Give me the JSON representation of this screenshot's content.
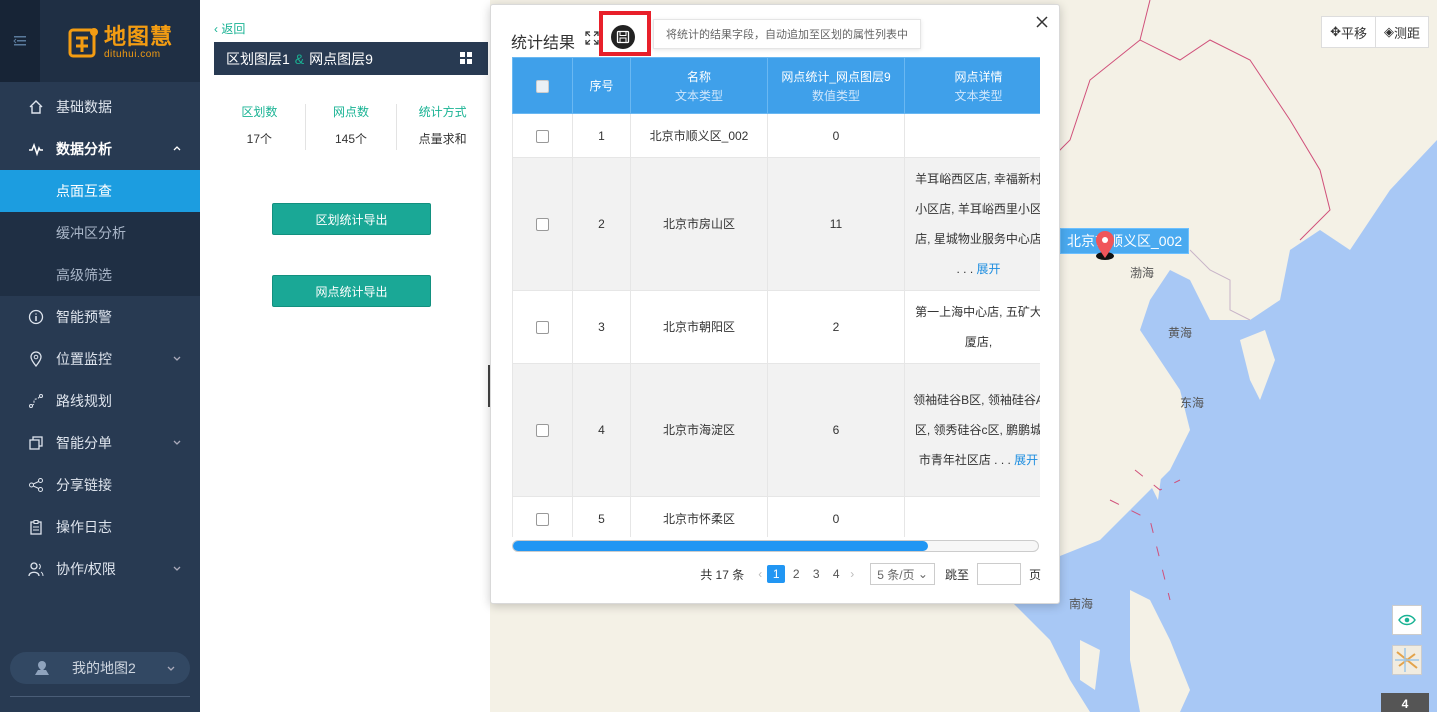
{
  "brand": {
    "name_cn": "地图慧",
    "name_en": "dituhui.com"
  },
  "sidebar": {
    "items": [
      {
        "label": "基础数据",
        "icon": "home-icon"
      },
      {
        "label": "数据分析",
        "icon": "analytics-icon",
        "expanded": true,
        "children": [
          {
            "label": "点面互查",
            "active": true
          },
          {
            "label": "缓冲区分析"
          },
          {
            "label": "高级筛选"
          }
        ]
      },
      {
        "label": "智能预警",
        "icon": "info-icon"
      },
      {
        "label": "位置监控",
        "icon": "location-icon"
      },
      {
        "label": "路线规划",
        "icon": "route-icon"
      },
      {
        "label": "智能分单",
        "icon": "copy-icon"
      },
      {
        "label": "分享链接",
        "icon": "share-icon"
      },
      {
        "label": "操作日志",
        "icon": "clipboard-icon"
      },
      {
        "label": "协作/权限",
        "icon": "users-icon"
      }
    ],
    "my_map": "我的地图2"
  },
  "panel": {
    "back": "返回",
    "layer_a": "区划图层1",
    "amp": "&",
    "layer_b": "网点图层9",
    "stats": [
      {
        "key": "区划数",
        "value": "17个"
      },
      {
        "key": "网点数",
        "value": "145个"
      },
      {
        "key": "统计方式",
        "value": "点量求和"
      }
    ],
    "export_region": "区划统计导出",
    "export_point": "网点统计导出"
  },
  "modal": {
    "title": "统计结果",
    "tooltip": "将统计的结果字段，自动追加至区划的属性列表中",
    "columns": [
      {
        "label": "序号",
        "type": ""
      },
      {
        "label": "名称",
        "type": "文本类型"
      },
      {
        "label": "网点统计_网点图层9",
        "type": "数值类型"
      },
      {
        "label": "网点详情",
        "type": "文本类型"
      }
    ],
    "rows": [
      {
        "index": "1",
        "name": "北京市顺义区_002",
        "count": "0",
        "detail": "",
        "more": ""
      },
      {
        "index": "2",
        "name": "北京市房山区",
        "count": "11",
        "detail": "羊耳峪西区店, 幸福新村小区店, 羊耳峪西里小区店, 星城物业服务中心店 . . .",
        "more": "展开"
      },
      {
        "index": "3",
        "name": "北京市朝阳区",
        "count": "2",
        "detail": "第一上海中心店, 五矿大厦店,",
        "more": ""
      },
      {
        "index": "4",
        "name": "北京市海淀区",
        "count": "6",
        "detail": "领袖硅谷B区, 领袖硅谷A区, 领秀硅谷c区, 鹏鹏城市青年社区店 . . .",
        "more": "展开"
      },
      {
        "index": "5",
        "name": "北京市怀柔区",
        "count": "0",
        "detail": "",
        "more": ""
      }
    ],
    "scroll_fraction": 0.79,
    "pager": {
      "total": "共 17 条",
      "pages": [
        "1",
        "2",
        "3",
        "4"
      ],
      "current": "1",
      "prev": "‹",
      "next": "›",
      "page_size": "5 条/页",
      "jump_label": "跳至",
      "page_unit": "页"
    }
  },
  "map": {
    "tools": [
      {
        "label": "平移",
        "icon": "move-icon"
      },
      {
        "label": "测距",
        "icon": "ruler-icon"
      }
    ],
    "marker_label": "北京市顺义区_002",
    "labels": [
      "渤海",
      "黄海",
      "东海",
      "南海"
    ],
    "zoom": "4",
    "colors": {
      "sea": "#a8c8f5",
      "land": "#f4f1e6",
      "border": "#d0507a"
    }
  }
}
